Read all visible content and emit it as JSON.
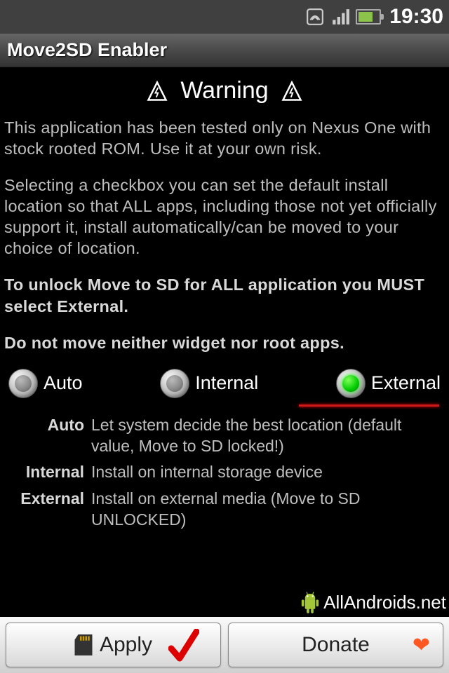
{
  "status": {
    "time": "19:30"
  },
  "title_bar": "Move2SD Enabler",
  "warning": {
    "heading": "Warning",
    "p1": "This application has been tested only on Nexus One with stock rooted ROM. Use it at your own risk.",
    "p2": "Selecting a checkbox you can set the default install location so that ALL apps, including those not yet officially support it, install automatically/can be moved to your choice of location.",
    "p3": "To unlock Move to SD for ALL application you MUST select External.",
    "p4": "Do not move neither widget nor root apps."
  },
  "radios": {
    "auto": "Auto",
    "internal": "Internal",
    "external": "External",
    "selected": "external"
  },
  "descriptions": {
    "auto": {
      "label": "Auto",
      "text": "Let system decide the best location (default value, Move to SD locked!)"
    },
    "internal": {
      "label": "Internal",
      "text": "Install on internal storage device"
    },
    "external": {
      "label": "External",
      "text": "Install on external media (Move to SD UNLOCKED)"
    }
  },
  "watermark": "AllAndroids.net",
  "buttons": {
    "apply": "Apply",
    "donate": "Donate"
  }
}
